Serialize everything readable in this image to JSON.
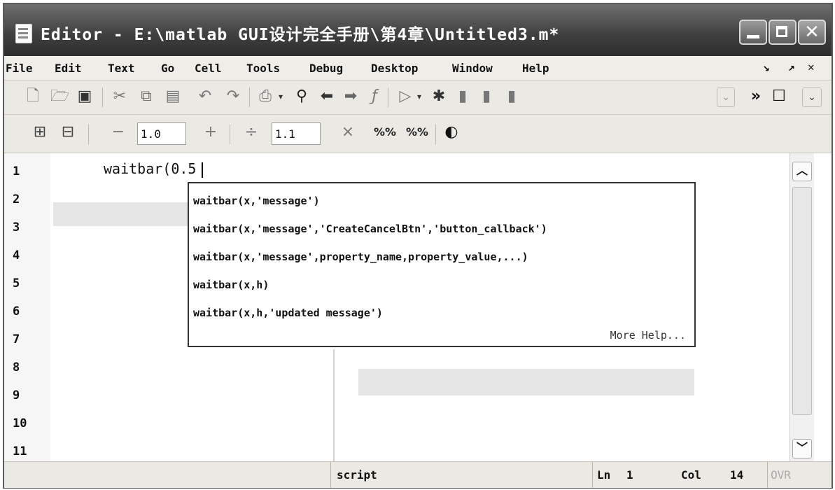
{
  "window": {
    "title": "Editor - E:\\matlab GUI设计完全手册\\第4章\\Untitled3.m*",
    "close_label": "✕"
  },
  "menubar": {
    "items": [
      "File",
      "Edit",
      "Text",
      "Go",
      "Cell",
      "Tools",
      "Debug",
      "Desktop",
      "Window",
      "Help"
    ],
    "undock_label": "↘",
    "maximize_label": "↗",
    "close_label": "✕"
  },
  "toolbar": {
    "more_label": "»",
    "cell_controls": {
      "decrement_value": "1.0",
      "divide_value": "1.1",
      "decrement_symbol": "−",
      "increment_symbol": "+",
      "divide_symbol": "÷",
      "multiply_symbol": "×",
      "insert_comment_label": "%%",
      "remove_comment_label": "%%"
    }
  },
  "editor": {
    "line_numbers": [
      "1",
      "2",
      "3",
      "4",
      "5",
      "6",
      "7",
      "8",
      "9",
      "10",
      "11"
    ],
    "code": "waitbar(0.5"
  },
  "autocomplete": {
    "items": [
      "waitbar(x,'message')",
      "waitbar(x,'message','CreateCancelBtn','button_callback')",
      "waitbar(x,'message',property_name,property_value,...)",
      "waitbar(x,h)",
      "waitbar(x,h,'updated message')"
    ],
    "more_help": "More Help..."
  },
  "statusbar": {
    "mode": "script",
    "ln_label": "Ln",
    "ln_value": "1",
    "col_label": "Col",
    "col_value": "14",
    "ovr_label": "OVR"
  },
  "icons": [
    "new-file-icon",
    "open-file-icon",
    "save-icon",
    "cut-icon",
    "copy-icon",
    "paste-icon",
    "undo-icon",
    "redo-icon",
    "print-icon",
    "find-icon",
    "back-icon",
    "forward-icon",
    "function-icon",
    "run-icon",
    "breakpoint-icon"
  ]
}
